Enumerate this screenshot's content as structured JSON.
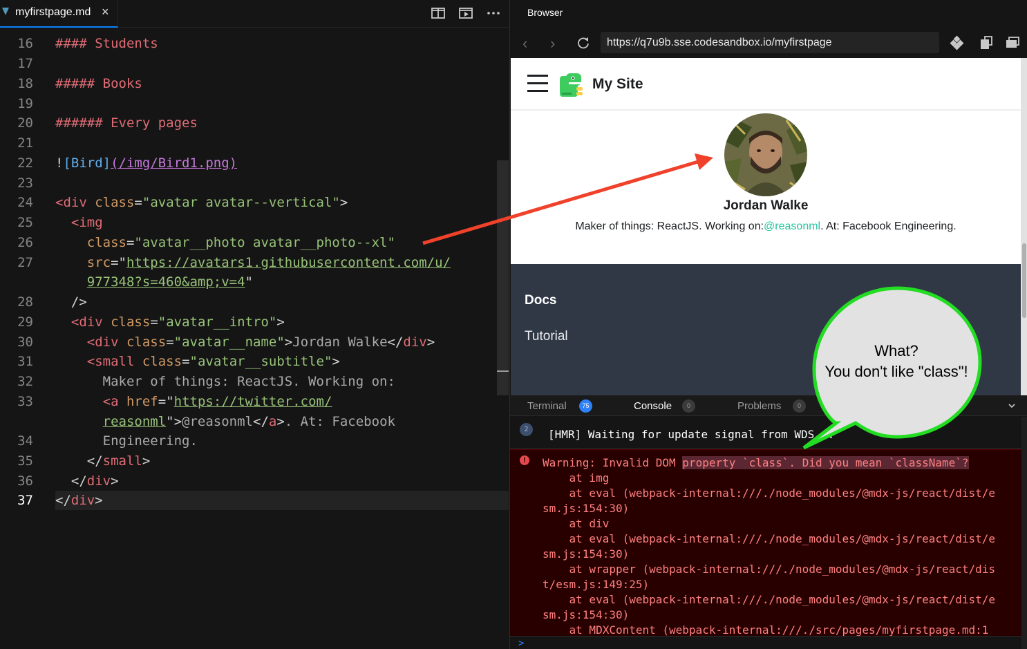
{
  "editor": {
    "tab_label": "myfirstpage.md",
    "close_glyph": "×",
    "toolbar_icons": [
      "split-editor-icon",
      "preview-icon",
      "more-icon"
    ],
    "active_line": "37",
    "line_numbers": [
      "16",
      "17",
      "18",
      "19",
      "20",
      "21",
      "22",
      "23",
      "24",
      "25",
      "26",
      "27",
      "28",
      "29",
      "30",
      "31",
      "32",
      "33",
      "34",
      "35",
      "36",
      "37"
    ]
  },
  "code": {
    "l16": "#### Students",
    "l18": "##### Books",
    "l20": "###### Every pages",
    "l22_bang": "!",
    "l22_alt": "[Bird]",
    "l22_src": "(/img/Bird1.png)",
    "l24_open": "<div",
    "l24_attr": "class",
    "l24_val": "\"avatar avatar--vertical\"",
    "l25_tag": "<img",
    "l26_attr": "class",
    "l26_val": "\"avatar__photo avatar__photo--xl\"",
    "l27_attr": "src",
    "l27_url": "https://avatars1.githubusercontent.com/u/",
    "l27b_url": "977348?s=460&amp;v=4",
    "l28": "/>",
    "l29_tag": "<div",
    "l29_attr": "class",
    "l29_val": "\"avatar__intro\"",
    "l30_tag": "<div",
    "l30_attr": "class",
    "l30_val": "\"avatar__name\"",
    "l30_text": "Jordan Walke",
    "l30_close": "div",
    "l31_tag": "<small",
    "l31_attr": "class",
    "l31_val": "\"avatar__subtitle\"",
    "l32": "Maker of things: ReactJS. Working on:",
    "l33_tag": "<a",
    "l33_attr": "href",
    "l33_url": "https://twitter.com/",
    "l33b_url": "reasonml",
    "l33b_text": "@reasonml",
    "l33b_close": "a",
    "l33b_rest": ". At: Facebook",
    "l34": "Engineering.",
    "l35_close": "small",
    "l36_close": "div",
    "l37_close": "div"
  },
  "browser": {
    "title": "Browser",
    "url": "https://q7u9b.sse.codesandbox.io/myfirstpage",
    "site_title": "My Site",
    "avatar_name": "Jordan Walke",
    "subtitle_pre": "Maker of things: ReactJS. Working on:",
    "subtitle_link": "@reasonml",
    "subtitle_post": ". At: Facebook Engineering.",
    "footer_heading": "Docs",
    "footer_link": "Tutorial"
  },
  "panel": {
    "tabs": [
      {
        "label": "Terminal",
        "count": "75"
      },
      {
        "label": "Console",
        "count": "0"
      },
      {
        "label": "Problems",
        "count": "0"
      }
    ],
    "hmr_count": "2",
    "hmr_text": "[HMR] Waiting for update signal from WDS...",
    "error_lines": [
      "Warning: Invalid DOM ",
      "property `class`. Did you mean `className`?",
      "    at img",
      "    at eval (webpack-internal:///./node_modules/@mdx-js/react/dist/e",
      "sm.js:154:30)",
      "    at div",
      "    at eval (webpack-internal:///./node_modules/@mdx-js/react/dist/e",
      "sm.js:154:30)",
      "    at wrapper (webpack-internal:///./node_modules/@mdx-js/react/dis",
      "t/esm.js:149:25)",
      "    at eval (webpack-internal:///./node_modules/@mdx-js/react/dist/e",
      "sm.js:154:30)",
      "    at MDXContent (webpack-internal:///./src/pages/myfirstpage.md:1"
    ],
    "prompt": ">"
  },
  "annotation": {
    "line1": "What?",
    "line2": "You don't like \"class\"!",
    "arrow_color": "#f0412b",
    "bubble_border_color": "#22dd22"
  }
}
